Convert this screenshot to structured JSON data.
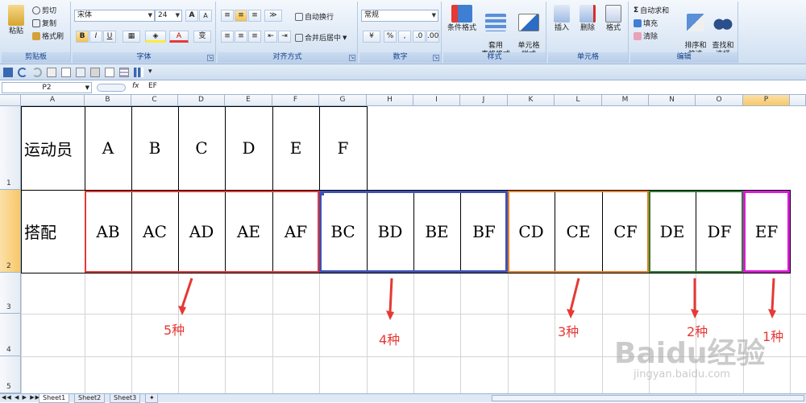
{
  "ribbon": {
    "clipboard": {
      "paste": "粘贴",
      "cut": "剪切",
      "copy": "复制",
      "format_painter": "格式刷",
      "label": "剪贴板"
    },
    "font": {
      "name": "宋体",
      "size": "24",
      "label": "字体",
      "bold": "B",
      "italic": "I",
      "underline": "U",
      "grow": "A",
      "shrink": "A",
      "color_a": "A",
      "phonetic": "变"
    },
    "alignment": {
      "wrap": "自动换行",
      "merge": "合并后居中",
      "label": "对齐方式"
    },
    "number": {
      "format": "常规",
      "percent": "%",
      "comma": ",",
      "label": "数字"
    },
    "styles": {
      "conditional": "条件格式",
      "table": "套用\n表格格式",
      "cell_styles": "单元格\n样式",
      "label": "样式"
    },
    "cells": {
      "insert": "插入",
      "delete": "删除",
      "format": "格式",
      "label": "单元格"
    },
    "editing": {
      "autosum": "自动求和",
      "fill": "填充",
      "clear": "清除",
      "sort": "排序和\n筛选",
      "find": "查找和\n选择",
      "label": "编辑"
    }
  },
  "formula_bar": {
    "name_box": "P2",
    "fx": "fx",
    "value": "EF"
  },
  "columns": [
    "A",
    "B",
    "C",
    "D",
    "E",
    "F",
    "G",
    "H",
    "I",
    "J",
    "K",
    "L",
    "M",
    "N",
    "O",
    "P"
  ],
  "rows": [
    "1",
    "2",
    "3",
    "4",
    "5"
  ],
  "row1": {
    "header": "运动员",
    "values": [
      "A",
      "B",
      "C",
      "D",
      "E",
      "F"
    ]
  },
  "row2": {
    "header": "搭配",
    "values": [
      "AB",
      "AC",
      "AD",
      "AE",
      "AF",
      "BC",
      "BD",
      "BE",
      "BF",
      "CD",
      "CE",
      "CF",
      "DE",
      "DF",
      "EF"
    ]
  },
  "annotations": [
    "5种",
    "4种",
    "3种",
    "2种",
    "1种"
  ],
  "sheets": [
    "Sheet1",
    "Sheet2",
    "Sheet3"
  ],
  "watermark": {
    "brand": "Baidu经验",
    "url": "jingyan.baidu.com"
  },
  "colors": {
    "red_box": "#e53935",
    "blue_box": "#3f51b5",
    "orange_box": "#e67e22",
    "green_box": "#2e7d32",
    "magenta_box": "#d81bd8",
    "selected_header": "#f8c868"
  }
}
